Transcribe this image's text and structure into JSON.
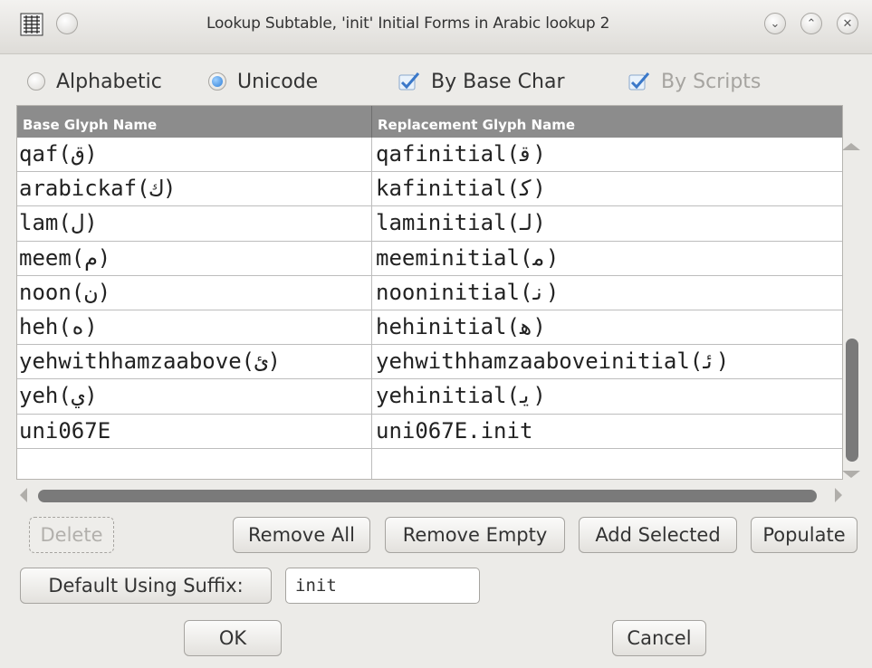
{
  "window": {
    "title": "Lookup Subtable, 'init' Initial Forms in Arabic lookup 2"
  },
  "options": {
    "alphabetic": "Alphabetic",
    "unicode": "Unicode",
    "by_base_char": "By Base Char",
    "by_scripts": "By Scripts"
  },
  "table": {
    "headers": [
      "Base Glyph Name",
      "Replacement Glyph Name"
    ],
    "rows": [
      [
        "qaf(ق)",
        "qafinitial(ﻗ)"
      ],
      [
        "arabickaf(ك)",
        "kafinitial(ﻛ)"
      ],
      [
        "lam(ل)",
        "laminitial(ﻟ)"
      ],
      [
        "meem(م)",
        "meeminitial(ﻣ)"
      ],
      [
        "noon(ن)",
        "nooninitial(ﻧ)"
      ],
      [
        "heh(ه)",
        "hehinitial(ﻫ)"
      ],
      [
        "yehwithhamzaabove(ئ)",
        "yehwithhamzaaboveinitial(ﺋ)"
      ],
      [
        "yeh(ي)",
        "yehinitial(ﻳ)"
      ],
      [
        "uni067E",
        "uni067E.init"
      ],
      [
        "",
        ""
      ]
    ]
  },
  "buttons": {
    "delete": "Delete",
    "remove_all": "Remove All",
    "remove_empty": "Remove Empty",
    "add_selected": "Add Selected",
    "populate": "Populate",
    "default_using_suffix": "Default Using Suffix:",
    "ok": "OK",
    "cancel": "Cancel"
  },
  "suffix": {
    "value": "init"
  },
  "icons": [
    "app-icon",
    "menu-circle-icon",
    "minimize-icon",
    "maximize-icon",
    "close-icon",
    "checkmark-icon"
  ]
}
